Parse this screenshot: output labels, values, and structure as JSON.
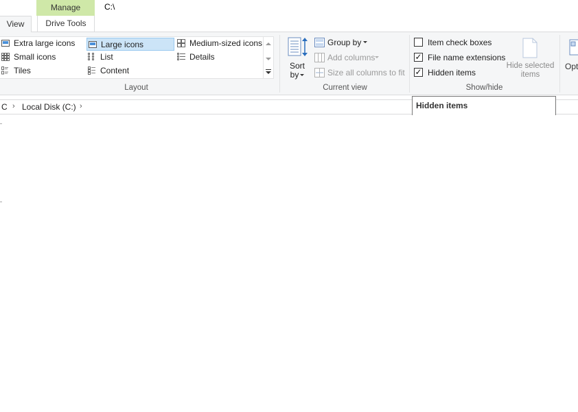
{
  "header": {
    "manage_tab": "Manage",
    "window_path": "C:\\"
  },
  "tabs": {
    "view": "View",
    "drive_tools": "Drive Tools"
  },
  "layout": {
    "items": [
      {
        "label": "Extra large icons",
        "icon": "extra-large-icons-icon",
        "selected": false
      },
      {
        "label": "Large icons",
        "icon": "large-icons-icon",
        "selected": true
      },
      {
        "label": "Medium-sized icons",
        "icon": "medium-icons-icon",
        "selected": false
      },
      {
        "label": "Small icons",
        "icon": "small-icons-icon",
        "selected": false
      },
      {
        "label": "List",
        "icon": "list-icon",
        "selected": false
      },
      {
        "label": "Details",
        "icon": "details-icon",
        "selected": false
      },
      {
        "label": "Tiles",
        "icon": "tiles-icon",
        "selected": false
      },
      {
        "label": "Content",
        "icon": "content-icon",
        "selected": false
      }
    ],
    "group_label": "Layout"
  },
  "current_view": {
    "sort_by_line1": "Sort",
    "sort_by_line2": "by",
    "group_by": "Group by",
    "add_columns": "Add columns",
    "size_columns": "Size all columns to fit",
    "group_label": "Current view"
  },
  "show_hide": {
    "item_check_boxes": {
      "label": "Item check boxes",
      "checked": false
    },
    "file_name_extensions": {
      "label": "File name extensions",
      "checked": true
    },
    "hidden_items": {
      "label": "Hidden items",
      "checked": true
    },
    "hide_selected_line1": "Hide selected",
    "hide_selected_line2": "items",
    "group_label": "Show/hide"
  },
  "options": {
    "label": "Opt"
  },
  "address": {
    "crumb_pc": "C",
    "crumb_disk": "Local Disk (C:)",
    "separator": "›"
  },
  "tooltip": {
    "title": "Hidden items"
  },
  "colors": {
    "manage_tab_bg": "#cfe8a8",
    "selected_bg": "#cce4f7",
    "ribbon_bg": "#f5f6f7"
  }
}
